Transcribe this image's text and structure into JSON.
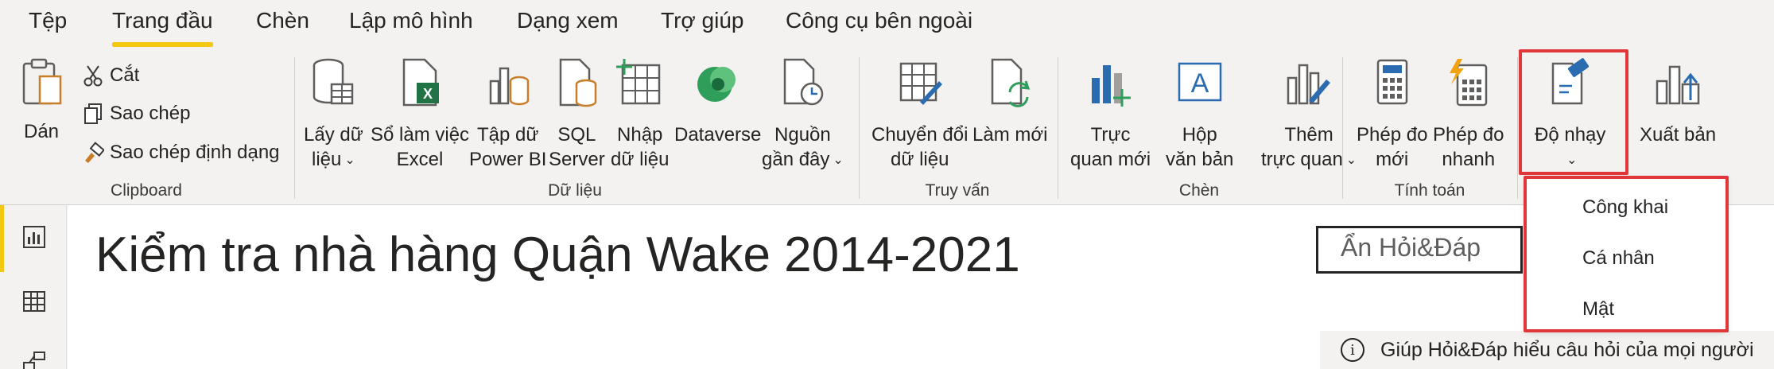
{
  "tabs": [
    {
      "label": "Tệp"
    },
    {
      "label": "Trang đầu"
    },
    {
      "label": "Chèn"
    },
    {
      "label": "Lập mô hình"
    },
    {
      "label": "Dạng xem"
    },
    {
      "label": "Trợ giúp"
    },
    {
      "label": "Công cụ bên ngoài"
    }
  ],
  "ribbon": {
    "clipboard": {
      "group": "Clipboard",
      "paste": "Dán",
      "cut": "Cắt",
      "copy": "Sao chép",
      "format_painter": "Sao chép định dạng"
    },
    "data": {
      "group": "Dữ liệu",
      "get_data": [
        "Lấy dữ",
        "liệu"
      ],
      "excel": [
        "Sổ làm việc",
        "Excel"
      ],
      "pbi": [
        "Tập dữ",
        "Power BI"
      ],
      "sql": [
        "SQL",
        "Server"
      ],
      "enter": [
        "Nhập",
        "dữ liệu"
      ],
      "dataverse": "Dataverse",
      "recent": [
        "Nguồn",
        "gần đây"
      ]
    },
    "queries": {
      "group": "Truy vấn",
      "transform": [
        "Chuyển đổi",
        "dữ liệu"
      ],
      "refresh": "Làm mới"
    },
    "insert": {
      "group": "Chèn",
      "new_visual": [
        "Trực",
        "quan mới"
      ],
      "text_box": [
        "Hộp",
        "văn bản"
      ],
      "more_visuals": [
        "Thêm",
        "trực quan"
      ]
    },
    "calculations": {
      "group": "Tính toán",
      "new_measure": [
        "Phép đo",
        "mới"
      ],
      "quick_measure": [
        "Phép đo",
        "nhanh"
      ]
    },
    "sensitivity": {
      "label": "Độ nhạy"
    },
    "publish": {
      "label": "Xuất bản"
    }
  },
  "canvas": {
    "title": "Kiểm tra nhà hàng Quận Wake 2014-2021",
    "qa_button": "Ẩn Hỏi&Đáp",
    "help_text": "Giúp Hỏi&Đáp hiểu câu hỏi của mọi người"
  },
  "sensitivity_menu": {
    "options": [
      "Công khai",
      "Cá nhân",
      "Mật"
    ]
  },
  "colors": {
    "accent": "#f2c811",
    "highlight": "#e0373a",
    "excel_green": "#217346",
    "dataverse_green": "#2e9e5a",
    "visual_blue": "#2b6cb0"
  }
}
